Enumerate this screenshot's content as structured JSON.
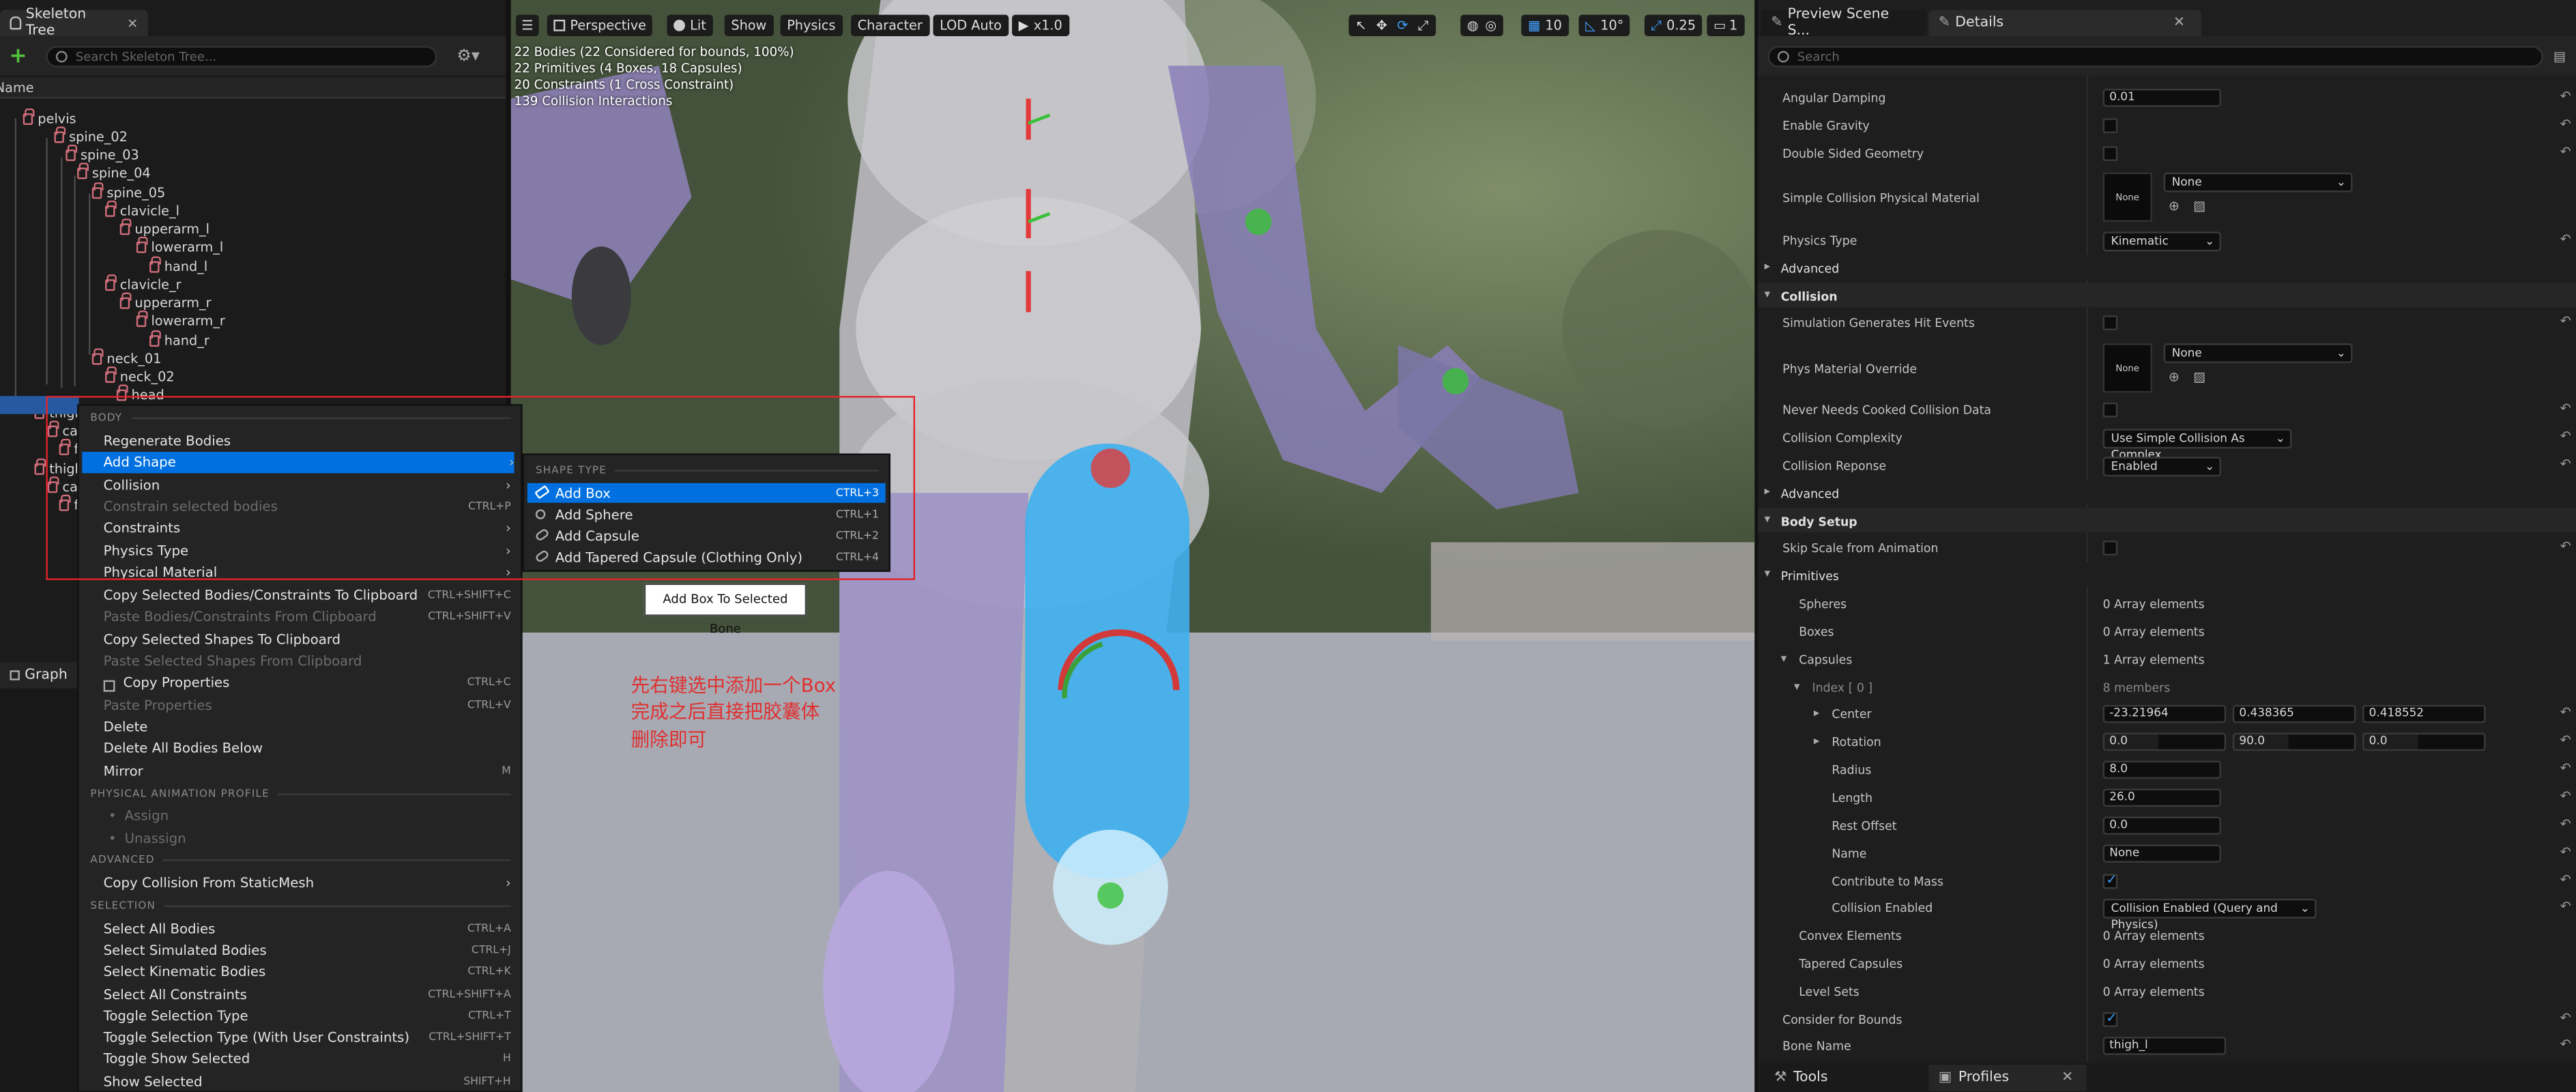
{
  "left_panel": {
    "tab_title": "Skeleton Tree",
    "search_placeholder": "Search Skeleton Tree...",
    "column_name": "Name",
    "bones": [
      "pelvis",
      "spine_02",
      "spine_03",
      "spine_04",
      "spine_05",
      "clavicle_l",
      "upperarm_l",
      "lowerarm_l",
      "hand_l",
      "clavicle_r",
      "upperarm_r",
      "lowerarm_r",
      "hand_r",
      "neck_01",
      "neck_02",
      "head",
      "thigh_l",
      "calf_l",
      "foot_l",
      "thigh_r",
      "calf_r",
      "foot_r"
    ],
    "graph_tab": "Graph"
  },
  "context_menu": {
    "sections": {
      "body": "BODY",
      "physical_animation_profile": "PHYSICAL ANIMATION PROFILE",
      "advanced": "ADVANCED",
      "selection": "SELECTION"
    },
    "items": {
      "regenerate": {
        "label": "Regenerate Bodies",
        "key": ""
      },
      "add_shape": {
        "label": "Add Shape",
        "key": ""
      },
      "collision": {
        "label": "Collision",
        "key": ""
      },
      "constrain": {
        "label": "Constrain selected bodies",
        "key": "CTRL+P"
      },
      "constraints": {
        "label": "Constraints",
        "key": ""
      },
      "physics_type": {
        "label": "Physics Type",
        "key": ""
      },
      "physical_material": {
        "label": "Physical Material",
        "key": ""
      },
      "copy_bodies": {
        "label": "Copy Selected Bodies/Constraints To Clipboard",
        "key": "CTRL+SHIFT+C"
      },
      "paste_bodies": {
        "label": "Paste Bodies/Constraints From Clipboard",
        "key": "CTRL+SHIFT+V"
      },
      "copy_shapes": {
        "label": "Copy Selected Shapes To Clipboard",
        "key": ""
      },
      "paste_shapes": {
        "label": "Paste Selected Shapes From Clipboard",
        "key": ""
      },
      "copy_props": {
        "label": "Copy Properties",
        "key": "CTRL+C"
      },
      "paste_props": {
        "label": "Paste Properties",
        "key": "CTRL+V"
      },
      "delete": {
        "label": "Delete",
        "key": ""
      },
      "delete_below": {
        "label": "Delete All Bodies Below",
        "key": ""
      },
      "mirror": {
        "label": "Mirror",
        "key": "M"
      },
      "assign": {
        "label": "Assign",
        "key": ""
      },
      "unassign": {
        "label": "Unassign",
        "key": ""
      },
      "copy_collision": {
        "label": "Copy Collision From StaticMesh",
        "key": ""
      },
      "sel_all": {
        "label": "Select All Bodies",
        "key": "CTRL+A"
      },
      "sel_sim": {
        "label": "Select Simulated Bodies",
        "key": "CTRL+J"
      },
      "sel_kin": {
        "label": "Select Kinematic Bodies",
        "key": "CTRL+K"
      },
      "sel_cons": {
        "label": "Select All Constraints",
        "key": "CTRL+SHIFT+A"
      },
      "toggle_sel": {
        "label": "Toggle Selection Type",
        "key": "CTRL+T"
      },
      "toggle_sel_uc": {
        "label": "Toggle Selection Type (With User Constraints)",
        "key": "CTRL+SHIFT+T"
      },
      "toggle_show": {
        "label": "Toggle Show Selected",
        "key": "H"
      },
      "show_sel": {
        "label": "Show Selected",
        "key": "SHIFT+H"
      }
    }
  },
  "submenu": {
    "header": "SHAPE TYPE",
    "items": [
      {
        "label": "Add Box",
        "key": "CTRL+3"
      },
      {
        "label": "Add Sphere",
        "key": "CTRL+1"
      },
      {
        "label": "Add Capsule",
        "key": "CTRL+2"
      },
      {
        "label": "Add Tapered Capsule (Clothing Only)",
        "key": "CTRL+4"
      }
    ],
    "tooltip": "Add Box To Selected Bone"
  },
  "annotation": {
    "line1": "先右键选中添加一个Box",
    "line2": "完成之后直接把胶囊体",
    "line3": "删除即可",
    "color": "#e03030"
  },
  "viewport": {
    "toolbar": {
      "perspective": "Perspective",
      "lit": "Lit",
      "show": "Show",
      "physics": "Physics",
      "character": "Character",
      "lod": "LOD Auto",
      "speed": "x1.0",
      "grid": "10",
      "angle": "10°",
      "scale": "0.25",
      "cam": "1"
    },
    "stats": [
      "22 Bodies (22 Considered for bounds, 100%)",
      "22 Primitives (4 Boxes, 18 Capsules)",
      "20 Constraints (1 Cross Constraint)",
      "139 Collision Interactions"
    ]
  },
  "right_panel": {
    "tabs": {
      "preview": "Preview Scene S...",
      "details": "Details",
      "tools": "Tools",
      "profiles": "Profiles"
    },
    "search_placeholder": "Search",
    "props": {
      "angular_damping": {
        "label": "Angular Damping",
        "value": "0.01"
      },
      "enable_gravity": {
        "label": "Enable Gravity"
      },
      "double_sided": {
        "label": "Double Sided Geometry"
      },
      "simple_mat": {
        "label": "Simple Collision Physical Material",
        "thumb": "None",
        "value": "None"
      },
      "physics_type": {
        "label": "Physics Type",
        "value": "Kinematic"
      },
      "advanced1": {
        "label": "Advanced"
      },
      "collision_cat": {
        "label": "Collision"
      },
      "sim_hit": {
        "label": "Simulation Generates Hit Events"
      },
      "phys_mat": {
        "label": "Phys Material Override",
        "thumb": "None",
        "value": "None"
      },
      "never_cooked": {
        "label": "Never Needs Cooked Collision Data"
      },
      "complexity": {
        "label": "Collision Complexity",
        "value": "Use Simple Collision As Complex"
      },
      "response": {
        "label": "Collision Reponse",
        "value": "Enabled"
      },
      "advanced2": {
        "label": "Advanced"
      },
      "body_setup": {
        "label": "Body Setup"
      },
      "skip_scale": {
        "label": "Skip Scale from Animation"
      },
      "primitives": {
        "label": "Primitives"
      },
      "spheres": {
        "label": "Spheres",
        "value": "0 Array elements"
      },
      "boxes": {
        "label": "Boxes",
        "value": "0 Array elements"
      },
      "capsules": {
        "label": "Capsules",
        "value": "1 Array elements"
      },
      "index0": {
        "label": "Index [ 0 ]",
        "value": "8 members"
      },
      "center": {
        "label": "Center",
        "x": "-23.21964",
        "y": "0.438365",
        "z": "0.418552"
      },
      "rotation": {
        "label": "Rotation",
        "x": "0.0",
        "y": "90.0",
        "z": "0.0"
      },
      "radius": {
        "label": "Radius",
        "value": "8.0"
      },
      "length": {
        "label": "Length",
        "value": "26.0"
      },
      "rest_offset": {
        "label": "Rest Offset",
        "value": "0.0"
      },
      "name": {
        "label": "Name",
        "value": "None"
      },
      "contrib_mass": {
        "label": "Contribute to Mass"
      },
      "coll_enabled": {
        "label": "Collision Enabled",
        "value": "Collision Enabled (Query and Physics)"
      },
      "convex": {
        "label": "Convex Elements",
        "value": "0 Array elements"
      },
      "tapered": {
        "label": "Tapered Capsules",
        "value": "0 Array elements"
      },
      "level_sets": {
        "label": "Level Sets",
        "value": "0 Array elements"
      },
      "consider_bounds": {
        "label": "Consider for Bounds"
      },
      "bone_name": {
        "label": "Bone Name",
        "value": "thigh_l"
      }
    }
  }
}
